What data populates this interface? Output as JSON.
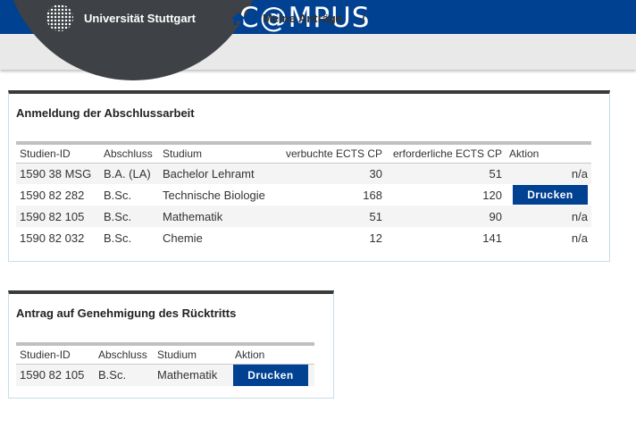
{
  "header": {
    "university": "Universität Stuttgart",
    "app_title": "C@MPUS",
    "brand_color": "#004191"
  },
  "breadcrumb": {
    "home_icon": "home-icon",
    "current": "Meine Anträge",
    "separator": "/"
  },
  "thesis_panel": {
    "title": "Anmeldung der Abschlussarbeit",
    "columns": [
      "Studien-ID",
      "Abschluss",
      "Studium",
      "verbuchte ECTS CP",
      "erforderliche ECTS CP",
      "Aktion"
    ],
    "rows": [
      {
        "id": "1590 38 MSG",
        "degree": "B.A. (LA)",
        "program": "Bachelor Lehramt",
        "booked": "30",
        "required": "51",
        "action": "n/a"
      },
      {
        "id": "1590 82 282",
        "degree": "B.Sc.",
        "program": "Technische Biologie",
        "booked": "168",
        "required": "120",
        "action": "Drucken"
      },
      {
        "id": "1590 82 105",
        "degree": "B.Sc.",
        "program": "Mathematik",
        "booked": "51",
        "required": "90",
        "action": "n/a"
      },
      {
        "id": "1590 82 032",
        "degree": "B.Sc.",
        "program": "Chemie",
        "booked": "12",
        "required": "141",
        "action": "n/a"
      }
    ]
  },
  "withdrawal_panel": {
    "title": "Antrag auf Genehmigung des Rücktritts",
    "columns": [
      "Studien-ID",
      "Abschluss",
      "Studium",
      "Aktion"
    ],
    "rows": [
      {
        "id": "1590 82 105",
        "degree": "B.Sc.",
        "program": "Mathematik",
        "action": "Drucken"
      }
    ]
  }
}
